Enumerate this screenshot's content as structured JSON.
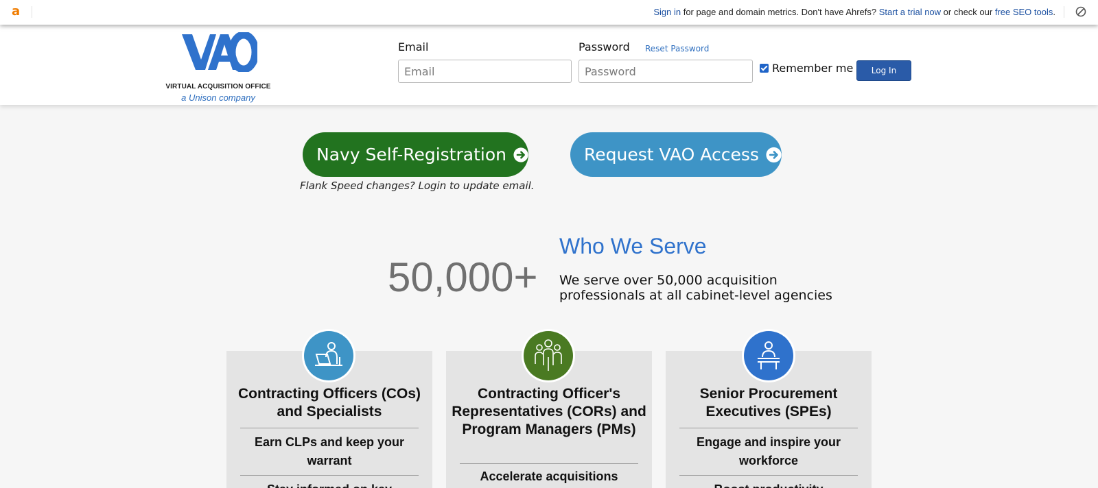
{
  "ahrefs_bar": {
    "logo": "a",
    "sign_in": "Sign in",
    "text_middle": " for page and domain metrics. Don't have Ahrefs? ",
    "trial": "Start a trial now",
    "text_or": " or check our ",
    "free_tools": "free SEO tools",
    "period": ".",
    "block_icon": "block-icon"
  },
  "header": {
    "logo_letters": "VAO",
    "logo_name": "VIRTUAL ACQUISITION OFFICE",
    "logo_tag": "a Unison company",
    "email_label": "Email",
    "email_placeholder": "Email",
    "email_value": "",
    "password_label": "Password",
    "password_placeholder": "Password",
    "password_value": "",
    "reset_password": "Reset Password",
    "remember_me": "Remember me",
    "remember_checked": true,
    "login_button": "Log In"
  },
  "cta": {
    "navy_label": "Navy Self-Registration",
    "navy_color": "#22731f",
    "vao_label": "Request VAO Access",
    "vao_color": "#3e94c6",
    "note": "Flank Speed changes? Login to update email."
  },
  "who_we_serve": {
    "stat": "50,000+",
    "title": "Who We Serve",
    "description": "We serve over 50,000 acquisition professionals at all cabinet-level agencies"
  },
  "cards": [
    {
      "icon": "person-at-laptop-icon",
      "icon_color": "#3e94c6",
      "title": "Contracting Officers (COs) and Specialists",
      "items": [
        "Earn CLPs and keep your warrant",
        "Stay informed on key"
      ]
    },
    {
      "icon": "group-of-people-icon",
      "icon_color": "#4a7a22",
      "title": "Contracting Officer's Representatives (CORs) and Program Managers (PMs)",
      "items": [
        "Accelerate acquisitions"
      ]
    },
    {
      "icon": "person-at-podium-icon",
      "icon_color": "#2f72cc",
      "title": "Senior Procurement Executives (SPEs)",
      "items": [
        "Engage and inspire your workforce",
        "Boost productivity"
      ]
    }
  ]
}
